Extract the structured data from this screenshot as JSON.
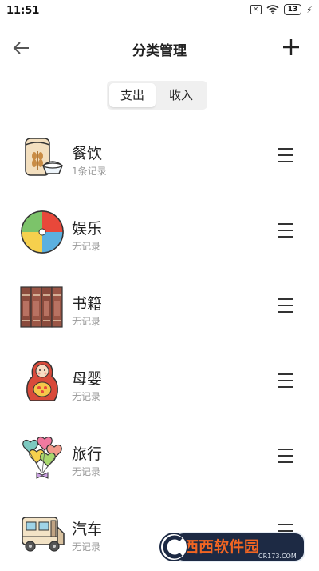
{
  "status_bar": {
    "time": "11:51",
    "sim_icon": "sim-x-icon",
    "wifi_icon": "wifi-icon",
    "battery": "13",
    "charging_icon": "bolt-icon"
  },
  "header": {
    "title": "分类管理",
    "back_icon": "arrow-left-icon",
    "add_icon": "plus-icon"
  },
  "tabs": [
    {
      "label": "支出",
      "active": true
    },
    {
      "label": "收入",
      "active": false
    }
  ],
  "categories": [
    {
      "name": "餐饮",
      "subtitle": "1条记录",
      "icon": "rice-bag-icon"
    },
    {
      "name": "娱乐",
      "subtitle": "无记录",
      "icon": "beach-ball-icon"
    },
    {
      "name": "书籍",
      "subtitle": "无记录",
      "icon": "books-icon"
    },
    {
      "name": "母婴",
      "subtitle": "无记录",
      "icon": "matryoshka-icon"
    },
    {
      "name": "旅行",
      "subtitle": "无记录",
      "icon": "balloons-icon"
    },
    {
      "name": "汽车",
      "subtitle": "无记录",
      "icon": "camper-van-icon"
    }
  ],
  "watermark": {
    "brand": "西西软件园",
    "url": "CR173.COM"
  }
}
